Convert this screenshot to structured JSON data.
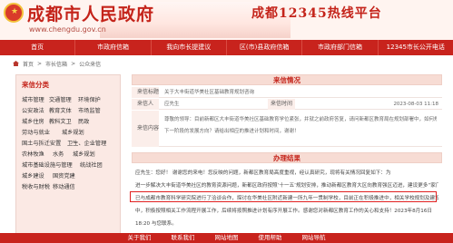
{
  "header": {
    "site_title": "成都市人民政府",
    "site_url": "www.chengdu.gov.cn",
    "hotline_title": "成都12345热线平台"
  },
  "nav": {
    "items": [
      "首页",
      "市政府信箱",
      "我向市长提建议",
      "区(市)县政府信箱",
      "市政府部门信箱",
      "12345市长公开电话"
    ]
  },
  "breadcrumb": {
    "items": [
      "首页",
      ">",
      "市长信箱",
      ">",
      "公众来信"
    ]
  },
  "categories": {
    "title": "来信分类",
    "items": [
      "城市管理",
      "交通管理",
      "环境保护",
      "公安政法",
      "教育文体",
      "市场监管",
      "城乡住房",
      "教科文卫",
      "民政",
      "劳动与就业",
      "城乡规划",
      "国土与拆迁安置",
      "卫生、企业管理",
      "农林牧渔",
      "水务",
      "城乡规划",
      "城市基础设施与管理",
      "统战社团",
      "城乡建设",
      "国资党建",
      "税收与财税",
      "移动通信"
    ]
  },
  "letter": {
    "section_title": "来信情况",
    "subject_label": "来信标题",
    "subject_value": "关于大丰街道华美社区基础教育规划咨询",
    "person_label": "来信人",
    "person_value": "应先生",
    "time_label": "来信时间",
    "time_value": "2023-08-03 11:18",
    "content_label": "来信内容",
    "content_line1": "尊敬的领导：目前新都区大丰街道华美社区基础教育学位紧张，并就之前政府答复，请问新都区教育局在规划部署中，如何规划",
    "content_line2": "下一阶段的发展方向？请给出相应的推进计划和时间，谢谢！"
  },
  "reply": {
    "section_title": "办理结果",
    "lines": [
      "应先生：您好！ 谢谢您的来电！您反映的问题，新都区教育局高度重视，经认真研究，现将有关情况回复如下：为",
      "进一步解决大丰街道华美社区的教育资源问题，新都区政府按照‘十一五’规划安排，推动新都区教育大区向教育强区迈进，建设更多“家门口好学校”，新都区政府",
      "已与成都市教育科学研究院进行了洽谈合作，探讨在华美社区附近新建一所九年一贯制学校，目前正在积极推进中，相关学校规划及建设正在按程序推进",
      "中，积极按照相关工作流程开展工作，后续将按照推进计划有序开展工作。感谢您对新都区教育工作的关心和支持！2023年8月16日",
      "18:20 与您联系。"
    ]
  },
  "footer": {
    "items": [
      "关于我们",
      "联系我们",
      "网站地图",
      "使用帮助",
      "网站导航"
    ]
  },
  "colors": {
    "brand_red": "#c8231d",
    "highlight": "#e02020"
  }
}
